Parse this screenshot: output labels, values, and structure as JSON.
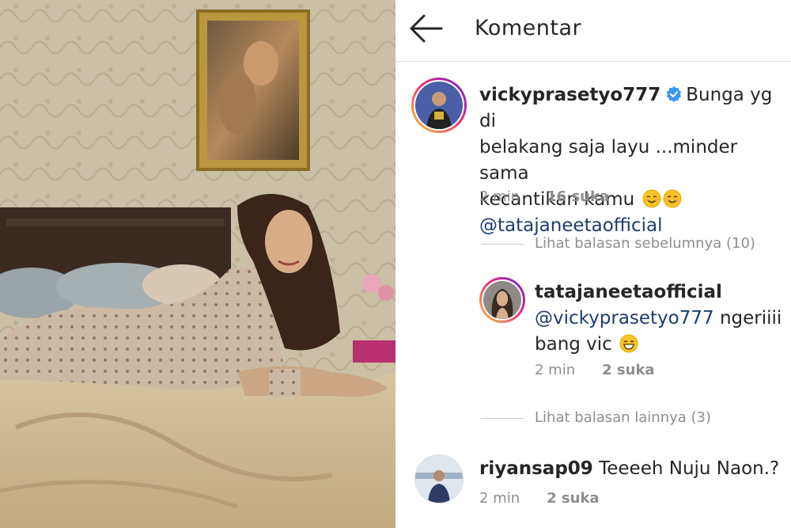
{
  "header": {
    "title": "Komentar",
    "back_icon": "arrow-left-icon"
  },
  "comments": [
    {
      "username": "vickyprasetyo777",
      "verified": true,
      "text_line1": "Bunga yg di",
      "text_line2": "belakang saja  layu ...minder sama",
      "text_line3": "kecantikan kamu",
      "emoji": "smiling-face-icon",
      "mention": "@tatajaneetaofficial",
      "time": "2 min",
      "likes": "16 suka"
    }
  ],
  "view_previous_replies": "Lihat balasan sebelumnya (10)",
  "reply": {
    "username": "tatajaneetaofficial",
    "mention": "@vickyprasetyo777",
    "text_line1_rest": "ngeriiii",
    "text_line2": "bang vic",
    "emoji": "grinning-face-icon",
    "time": "2 min",
    "likes": "2 suka"
  },
  "view_more_replies": "Lihat balasan lainnya (3)",
  "comment3": {
    "username": "riyansap09",
    "text": "Teeeeh Nuju Naon.?",
    "time": "2 min",
    "likes": "2 suka"
  },
  "colors": {
    "mention": "#1c3e6e",
    "meta": "#8e8e8e",
    "verified_badge": "#3897f0"
  }
}
